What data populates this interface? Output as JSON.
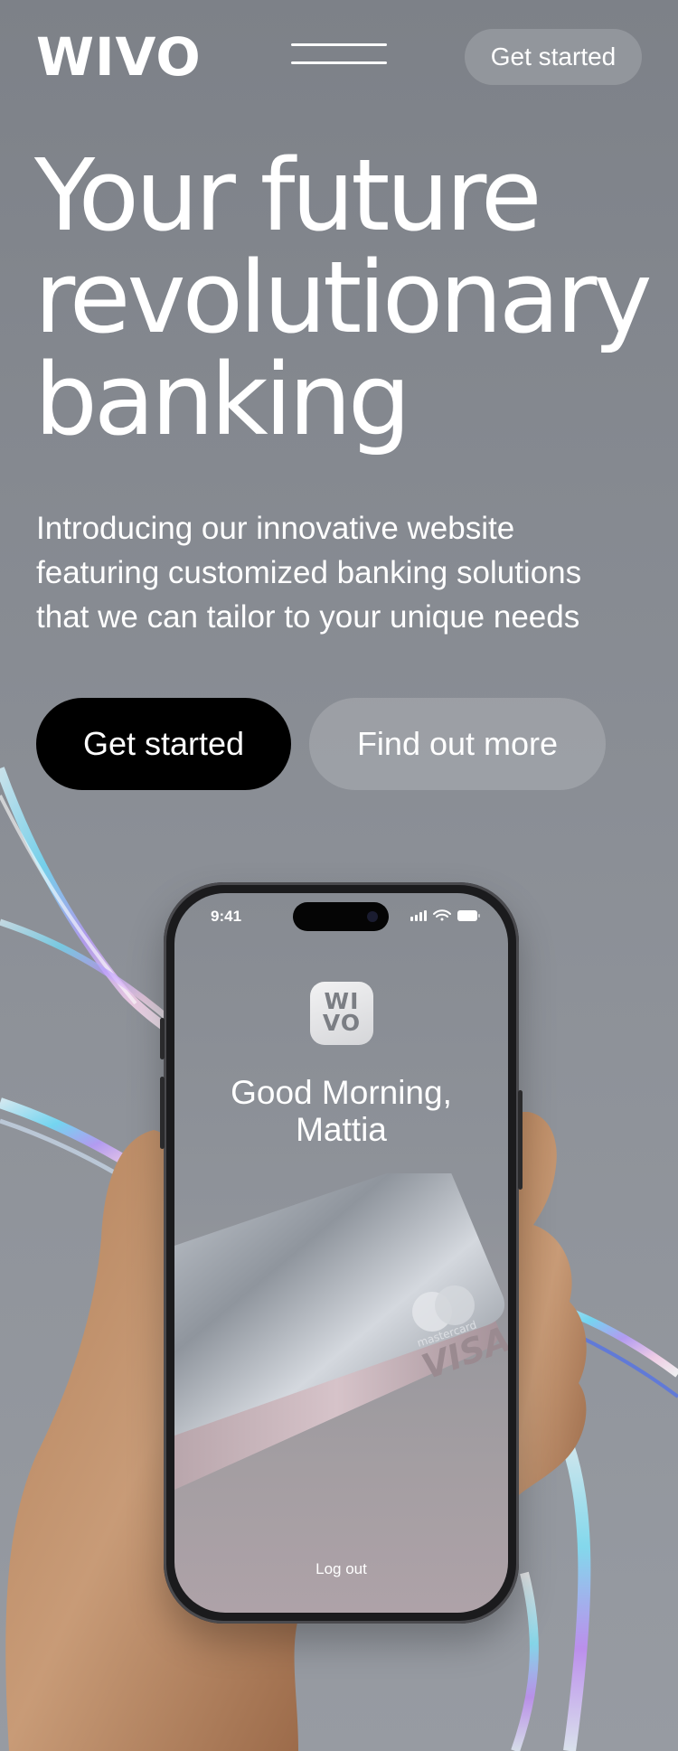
{
  "header": {
    "logo": "WIVO",
    "menu_icon": "hamburger-menu-icon",
    "cta_label": "Get started"
  },
  "hero": {
    "title_lines": [
      "Your future",
      "revolutionary",
      "banking"
    ],
    "description_lines": [
      "Introducing our innovative website",
      "featuring customized banking solutions",
      "that we can tailor to your unique needs"
    ],
    "primary_button": "Get started",
    "secondary_button": "Find out more"
  },
  "phone": {
    "status_time": "9:41",
    "status_icons": [
      "signal-icon",
      "wifi-icon",
      "battery-icon"
    ],
    "app_logo_lines": [
      "WI",
      "VO"
    ],
    "greeting_lines": [
      "Good Morning,",
      "Mattia"
    ],
    "cards": [
      {
        "brand": "mastercard",
        "icon": "mastercard-logo-icon"
      },
      {
        "brand": "VISA",
        "icon": "visa-logo-icon"
      }
    ],
    "logout_label": "Log out"
  },
  "colors": {
    "background": "#868a91",
    "primary_button": "#000000",
    "secondary_button": "rgba(255,255,255,0.16)",
    "text": "#ffffff"
  }
}
